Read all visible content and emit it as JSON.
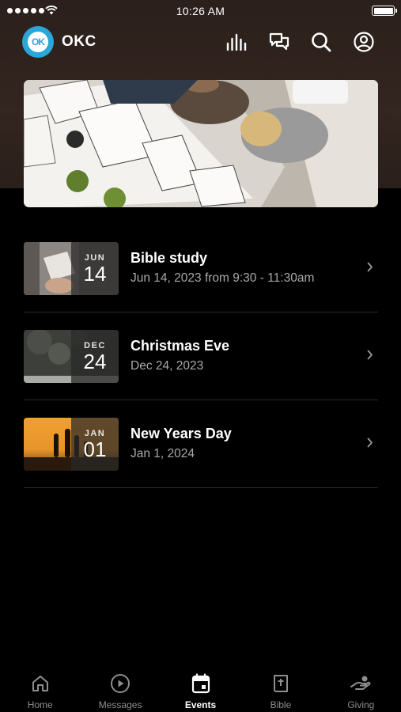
{
  "status_bar": {
    "time": "10:26 AM"
  },
  "header": {
    "logo_text": "OK",
    "org_name": "OKC",
    "icons": [
      "activity-icon",
      "chat-icon",
      "search-icon",
      "profile-icon"
    ]
  },
  "events": [
    {
      "month": "JUN",
      "day": "14",
      "title": "Bible study",
      "subtitle": "Jun 14, 2023 from 9:30 - 11:30am"
    },
    {
      "month": "DEC",
      "day": "24",
      "title": "Christmas Eve",
      "subtitle": "Dec 24, 2023"
    },
    {
      "month": "JAN",
      "day": "01",
      "title": "New Years Day",
      "subtitle": "Jan 1, 2024"
    }
  ],
  "tabs": [
    {
      "label": "Home",
      "icon": "home-icon",
      "active": false
    },
    {
      "label": "Messages",
      "icon": "play-icon",
      "active": false
    },
    {
      "label": "Events",
      "icon": "calendar-icon",
      "active": true
    },
    {
      "label": "Bible",
      "icon": "bible-icon",
      "active": false
    },
    {
      "label": "Giving",
      "icon": "giving-icon",
      "active": false
    }
  ],
  "colors": {
    "accent": "#2aa7d8",
    "background": "#000000",
    "header_bg": "#2e221d",
    "muted_text": "#a9a9a9"
  }
}
